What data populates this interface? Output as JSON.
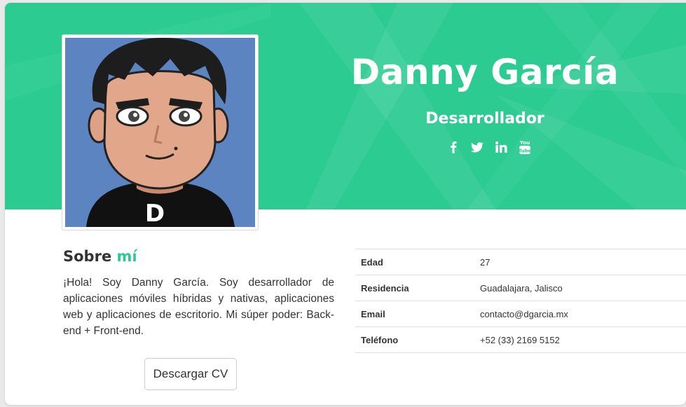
{
  "profile": {
    "name": "Danny García",
    "role": "Desarrollador",
    "avatar_letter": "D"
  },
  "social": [
    {
      "icon": "facebook-icon",
      "glyph": "f"
    },
    {
      "icon": "twitter-icon",
      "glyph": "twitter"
    },
    {
      "icon": "linkedin-icon",
      "glyph": "in"
    },
    {
      "icon": "youtube-icon",
      "glyph": "You Tube"
    }
  ],
  "about": {
    "title_prefix": "Sobre",
    "title_accent": "mí",
    "text": "¡Hola! Soy Danny García. Soy desarrollador de aplicaciones móviles híbridas y nativas, aplicaciones web y aplicaciones de escritorio. Mi súper poder: Back-end + Front-end.",
    "cv_button": "Descargar CV"
  },
  "info": [
    {
      "label": "Edad",
      "value": "27"
    },
    {
      "label": "Residencia",
      "value": "Guadalajara, Jalisco"
    },
    {
      "label": "Email",
      "value": "contacto@dgarcia.mx"
    },
    {
      "label": "Teléfono",
      "value": "+52 (33) 2169 5152"
    }
  ],
  "colors": {
    "accent": "#2bcb92",
    "avatar_bg": "#5b84c0"
  }
}
